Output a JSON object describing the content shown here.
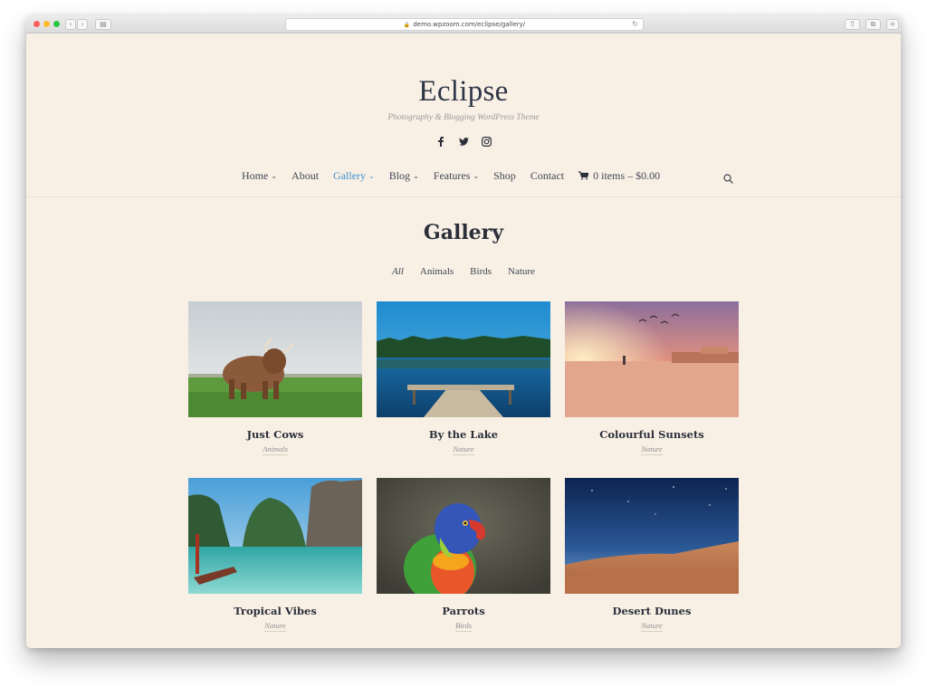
{
  "browser": {
    "url": "demo.wpzoom.com/eclipse/gallery/"
  },
  "site": {
    "title": "Eclipse",
    "tagline": "Photography & Blogging WordPress Theme",
    "social": [
      "facebook-icon",
      "twitter-icon",
      "instagram-icon"
    ]
  },
  "nav": {
    "items": [
      {
        "label": "Home",
        "dropdown": true
      },
      {
        "label": "About",
        "dropdown": false
      },
      {
        "label": "Gallery",
        "dropdown": true,
        "active": true
      },
      {
        "label": "Blog",
        "dropdown": true
      },
      {
        "label": "Features",
        "dropdown": true
      },
      {
        "label": "Shop",
        "dropdown": false
      },
      {
        "label": "Contact",
        "dropdown": false
      }
    ],
    "cart_label": "0 items – $0.00",
    "accent_color": "#3b8fcf"
  },
  "page": {
    "title": "Gallery",
    "filters": [
      "All",
      "Animals",
      "Birds",
      "Nature"
    ]
  },
  "gallery": [
    {
      "title": "Just Cows",
      "category": "Animals"
    },
    {
      "title": "By the Lake",
      "category": "Nature"
    },
    {
      "title": "Colourful Sunsets",
      "category": "Nature"
    },
    {
      "title": "Tropical Vibes",
      "category": "Nature"
    },
    {
      "title": "Parrots",
      "category": "Birds"
    },
    {
      "title": "Desert Dunes",
      "category": "Nature"
    }
  ]
}
